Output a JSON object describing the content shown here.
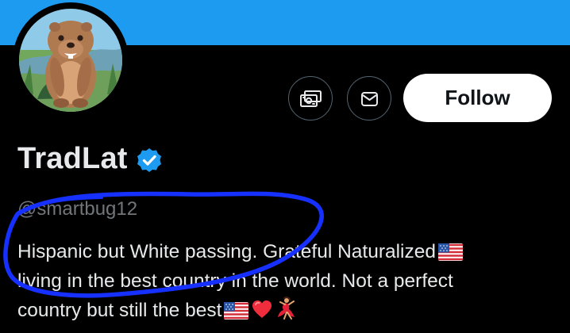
{
  "profile": {
    "display_name": "TradLat",
    "handle": "@smartbug12",
    "verified_badge": "verified-badge-icon",
    "bio_lines": [
      "Hispanic but White passing. Grateful Naturalized",
      "living in the best country in the world. Not a perfect",
      "country but still the best"
    ],
    "bio_emojis": {
      "line_1": "us-flag-emoji",
      "line_3": [
        "us-flag-emoji",
        "red-heart-emoji",
        "dancing-woman-emoji"
      ]
    }
  },
  "actions": {
    "tip_icon": "money-tip-icon",
    "message_icon": "envelope-icon",
    "follow_label": "Follow"
  },
  "media": {
    "avatar": "capybara-avatar-illustration"
  },
  "annotation": {
    "shape": "hand-drawn-blue-circle",
    "target": "bio-text"
  },
  "colors": {
    "banner": "#1d9bf0",
    "background": "#000000",
    "primary_text": "#e7e9ea",
    "secondary_text": "#71767b",
    "follow_button_bg": "#ffffff",
    "follow_button_text": "#0f1419",
    "verified_badge": "#1d9bf0",
    "annotation_ink": "#1630ff"
  }
}
